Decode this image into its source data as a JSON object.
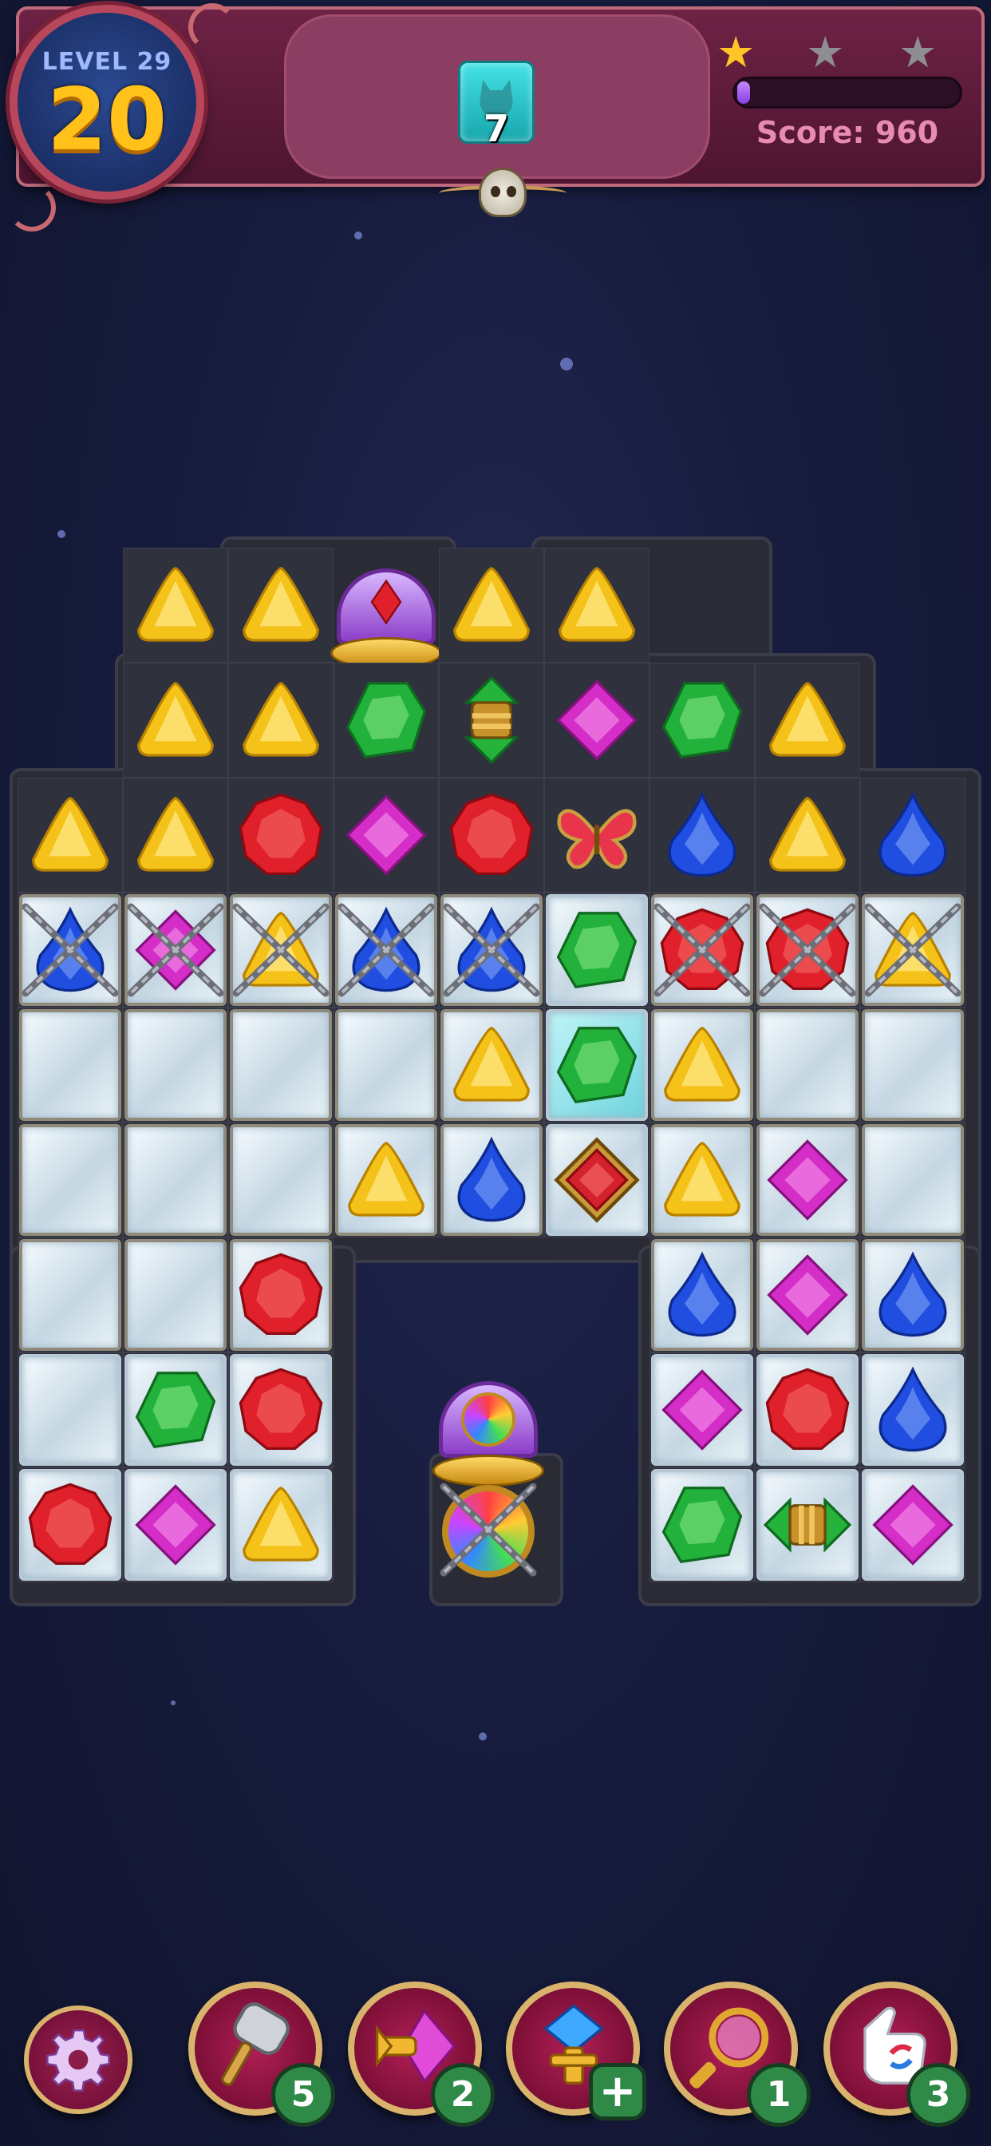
{
  "header": {
    "level_label": "LEVEL 29",
    "moves_left": "20",
    "goal": {
      "icon": "teal-cat-tile-icon",
      "count": "7"
    },
    "stars": {
      "earned": 1,
      "total": 3,
      "earned_color": "#ffc526",
      "empty_color": "#8e8e92"
    },
    "progress": 0.05,
    "score_text": "Score: 960"
  },
  "board": {
    "rows": [
      [
        "",
        "yellow",
        "yellow",
        "blocker",
        "yellow",
        "yellow",
        "",
        "",
        ""
      ],
      [
        "",
        "yellow",
        "yellow",
        "green",
        "spinner",
        "purple",
        "green",
        "yellow",
        ""
      ],
      [
        "yellow",
        "yellow",
        "red",
        "purple",
        "red",
        "butterfly",
        "blue",
        "yellow",
        "blue"
      ],
      [
        "blue-chained-frosted",
        "purple-chained-frosted",
        "yellow-chained-frosted",
        "blue-chained-frosted",
        "blue-chained-frosted",
        "green-ice",
        "red-chained-frosted",
        "red-chained-frosted",
        "yellow-chained-frosted"
      ],
      [
        "frosted",
        "frosted",
        "frosted",
        "frosted",
        "yellow-frosted",
        "green-ice-teal",
        "yellow-frosted",
        "frosted",
        "frosted"
      ],
      [
        "frosted",
        "frosted",
        "frosted",
        "yellow-frosted",
        "blue-frosted",
        "red-framed-ice",
        "yellow-frosted",
        "purple-frosted",
        "frosted"
      ],
      [
        "frosted",
        "frosted",
        "red-frosted",
        "",
        "",
        "",
        "blue-frosted",
        "purple-frosted",
        "blue-frosted"
      ],
      [
        "ice",
        "green-ice",
        "red-ice",
        "",
        "",
        "",
        "purple-ice",
        "red-ice",
        "blue-ice"
      ],
      [
        "red-ice",
        "purple-ice",
        "yellow-ice",
        "",
        "",
        "",
        "green-ice",
        "spinner-h-ice",
        "purple-ice"
      ]
    ],
    "colors": {
      "yellow": "#f5c21a",
      "green": "#22b23b",
      "red": "#e0202a",
      "blue": "#1f4ee0",
      "purple": "#d52ec8"
    }
  },
  "boosters": [
    {
      "name": "hammer",
      "icon": "hammer-icon",
      "count": "5"
    },
    {
      "name": "arrow-gem",
      "icon": "arrow-gem-icon",
      "count": "2"
    },
    {
      "name": "pin-gem",
      "icon": "pin-gem-icon",
      "count": "+"
    },
    {
      "name": "magnifier",
      "icon": "magnifier-orb-icon",
      "count": "1"
    },
    {
      "name": "swap-hand",
      "icon": "swap-hand-icon",
      "count": "3"
    }
  ],
  "settings": {
    "icon": "gear-icon"
  }
}
